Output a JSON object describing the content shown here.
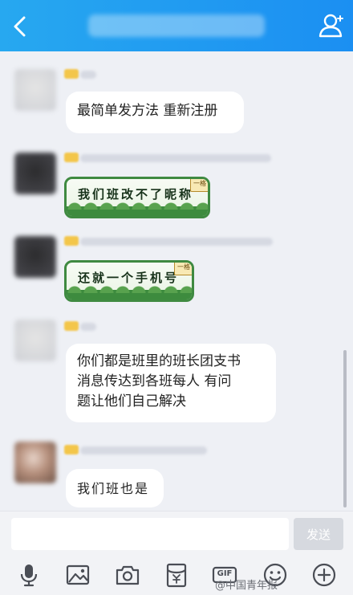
{
  "colors": {
    "top_bar": "#1b8ff2",
    "bubble": "#ffffff",
    "chat_bg": "#eef0f5",
    "sticker_border": "#3f8a41"
  },
  "header": {
    "back_icon": "chevron-left-icon",
    "profile_icon": "person-icon"
  },
  "messages": [
    {
      "type": "text",
      "text": "最简单发方法 重新注册"
    },
    {
      "type": "sticker",
      "text": "我们班改不了昵称",
      "tag": "一格"
    },
    {
      "type": "sticker",
      "text": "还就一个手机号",
      "tag": "一格"
    },
    {
      "type": "text",
      "lines": [
        "你们都是班里的班长团支书",
        "消息传达到各班每人  有问",
        "题让他们自己解决"
      ]
    },
    {
      "type": "text",
      "text": "我们班也是"
    }
  ],
  "input": {
    "value": "",
    "send_label": "发送"
  },
  "toolbar": {
    "icons": [
      "microphone-icon",
      "image-icon",
      "camera-icon",
      "red-packet-icon",
      "gif-icon",
      "emoji-icon",
      "plus-icon"
    ],
    "gif_label": "GIF"
  },
  "watermark": "@中国青年报"
}
